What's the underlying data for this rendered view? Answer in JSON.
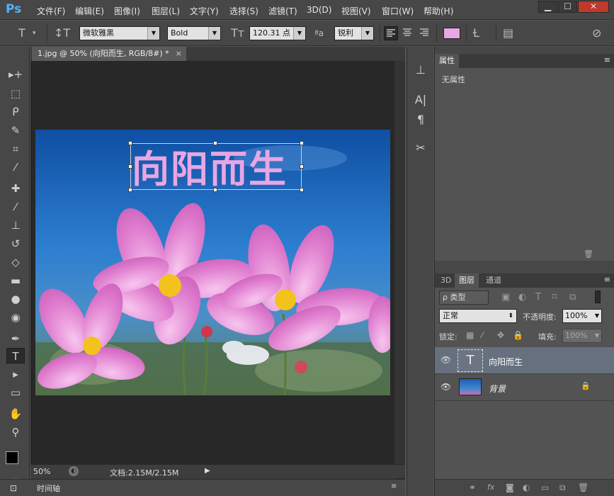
{
  "app": {
    "logo": "Ps"
  },
  "menu": {
    "items": [
      "文件(F)",
      "编辑(E)",
      "图像(I)",
      "图层(L)",
      "文字(Y)",
      "选择(S)",
      "滤镜(T)",
      "3D(D)",
      "视图(V)",
      "窗口(W)",
      "帮助(H)"
    ]
  },
  "window_controls": {
    "minimize": "▁",
    "maximize": "☐",
    "close": "✕"
  },
  "options": {
    "font_family": "微软雅黑",
    "font_style": "Bold",
    "font_size": "120.31 点",
    "aa_label": "ªa",
    "antialias": "锐利"
  },
  "document": {
    "tab_title": "1.jpg @ 50% (向阳而生, RGB/8#) *",
    "tab_close": "×",
    "canvas_text": "向阳而生",
    "zoom": "50%",
    "doc_info": "文档:2.15M/2.15M"
  },
  "timeline": {
    "label": "时间轴"
  },
  "properties": {
    "tab": "属性",
    "empty": "无属性"
  },
  "layers": {
    "tabs": [
      "3D",
      "图层",
      "通道"
    ],
    "filter_kind": "ρ 类型",
    "blend_mode": "正常",
    "opacity_label": "不透明度:",
    "opacity_value": "100%",
    "lock_label": "锁定:",
    "fill_label": "填充:",
    "fill_value": "100%",
    "items": [
      {
        "name": "向阳而生",
        "thumb": "T"
      },
      {
        "name": "背景"
      }
    ]
  },
  "colors": {
    "accent": "#4fb3ff",
    "swatch": "#e8a6e3",
    "selected_layer": "#66707f"
  }
}
